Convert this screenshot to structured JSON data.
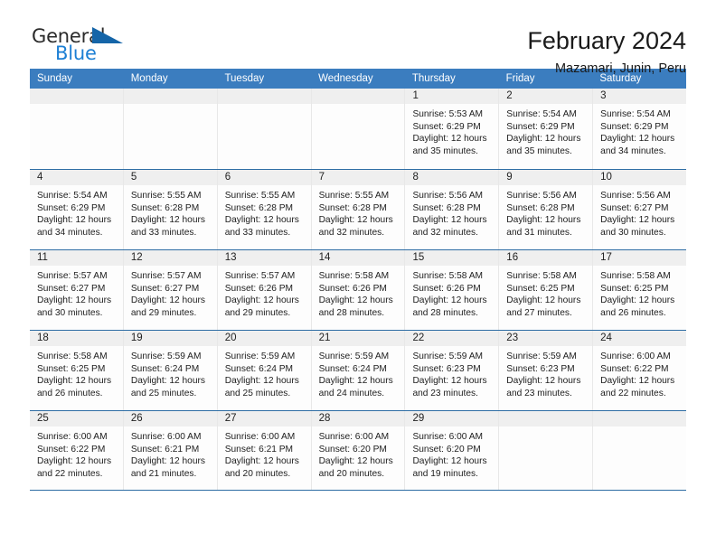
{
  "brand": {
    "word_one": "General",
    "word_two": "Blue",
    "triangle_icon": "triangle-icon",
    "accent_color": "#1c7fd4",
    "triangle_color": "#1565a8"
  },
  "header": {
    "title": "February 2024",
    "subtitle": "Mazamari, Junin, Peru"
  },
  "calendar": {
    "header_bg": "#3b7dbf",
    "row_rule_color": "#2e6da4",
    "daynum_bg": "#efefef",
    "day_names": [
      "Sunday",
      "Monday",
      "Tuesday",
      "Wednesday",
      "Thursday",
      "Friday",
      "Saturday"
    ],
    "weeks": [
      [
        {
          "day": "",
          "lines": []
        },
        {
          "day": "",
          "lines": []
        },
        {
          "day": "",
          "lines": []
        },
        {
          "day": "",
          "lines": []
        },
        {
          "day": "1",
          "lines": [
            "Sunrise: 5:53 AM",
            "Sunset: 6:29 PM",
            "Daylight: 12 hours",
            "and 35 minutes."
          ]
        },
        {
          "day": "2",
          "lines": [
            "Sunrise: 5:54 AM",
            "Sunset: 6:29 PM",
            "Daylight: 12 hours",
            "and 35 minutes."
          ]
        },
        {
          "day": "3",
          "lines": [
            "Sunrise: 5:54 AM",
            "Sunset: 6:29 PM",
            "Daylight: 12 hours",
            "and 34 minutes."
          ]
        }
      ],
      [
        {
          "day": "4",
          "lines": [
            "Sunrise: 5:54 AM",
            "Sunset: 6:29 PM",
            "Daylight: 12 hours",
            "and 34 minutes."
          ]
        },
        {
          "day": "5",
          "lines": [
            "Sunrise: 5:55 AM",
            "Sunset: 6:28 PM",
            "Daylight: 12 hours",
            "and 33 minutes."
          ]
        },
        {
          "day": "6",
          "lines": [
            "Sunrise: 5:55 AM",
            "Sunset: 6:28 PM",
            "Daylight: 12 hours",
            "and 33 minutes."
          ]
        },
        {
          "day": "7",
          "lines": [
            "Sunrise: 5:55 AM",
            "Sunset: 6:28 PM",
            "Daylight: 12 hours",
            "and 32 minutes."
          ]
        },
        {
          "day": "8",
          "lines": [
            "Sunrise: 5:56 AM",
            "Sunset: 6:28 PM",
            "Daylight: 12 hours",
            "and 32 minutes."
          ]
        },
        {
          "day": "9",
          "lines": [
            "Sunrise: 5:56 AM",
            "Sunset: 6:28 PM",
            "Daylight: 12 hours",
            "and 31 minutes."
          ]
        },
        {
          "day": "10",
          "lines": [
            "Sunrise: 5:56 AM",
            "Sunset: 6:27 PM",
            "Daylight: 12 hours",
            "and 30 minutes."
          ]
        }
      ],
      [
        {
          "day": "11",
          "lines": [
            "Sunrise: 5:57 AM",
            "Sunset: 6:27 PM",
            "Daylight: 12 hours",
            "and 30 minutes."
          ]
        },
        {
          "day": "12",
          "lines": [
            "Sunrise: 5:57 AM",
            "Sunset: 6:27 PM",
            "Daylight: 12 hours",
            "and 29 minutes."
          ]
        },
        {
          "day": "13",
          "lines": [
            "Sunrise: 5:57 AM",
            "Sunset: 6:26 PM",
            "Daylight: 12 hours",
            "and 29 minutes."
          ]
        },
        {
          "day": "14",
          "lines": [
            "Sunrise: 5:58 AM",
            "Sunset: 6:26 PM",
            "Daylight: 12 hours",
            "and 28 minutes."
          ]
        },
        {
          "day": "15",
          "lines": [
            "Sunrise: 5:58 AM",
            "Sunset: 6:26 PM",
            "Daylight: 12 hours",
            "and 28 minutes."
          ]
        },
        {
          "day": "16",
          "lines": [
            "Sunrise: 5:58 AM",
            "Sunset: 6:25 PM",
            "Daylight: 12 hours",
            "and 27 minutes."
          ]
        },
        {
          "day": "17",
          "lines": [
            "Sunrise: 5:58 AM",
            "Sunset: 6:25 PM",
            "Daylight: 12 hours",
            "and 26 minutes."
          ]
        }
      ],
      [
        {
          "day": "18",
          "lines": [
            "Sunrise: 5:58 AM",
            "Sunset: 6:25 PM",
            "Daylight: 12 hours",
            "and 26 minutes."
          ]
        },
        {
          "day": "19",
          "lines": [
            "Sunrise: 5:59 AM",
            "Sunset: 6:24 PM",
            "Daylight: 12 hours",
            "and 25 minutes."
          ]
        },
        {
          "day": "20",
          "lines": [
            "Sunrise: 5:59 AM",
            "Sunset: 6:24 PM",
            "Daylight: 12 hours",
            "and 25 minutes."
          ]
        },
        {
          "day": "21",
          "lines": [
            "Sunrise: 5:59 AM",
            "Sunset: 6:24 PM",
            "Daylight: 12 hours",
            "and 24 minutes."
          ]
        },
        {
          "day": "22",
          "lines": [
            "Sunrise: 5:59 AM",
            "Sunset: 6:23 PM",
            "Daylight: 12 hours",
            "and 23 minutes."
          ]
        },
        {
          "day": "23",
          "lines": [
            "Sunrise: 5:59 AM",
            "Sunset: 6:23 PM",
            "Daylight: 12 hours",
            "and 23 minutes."
          ]
        },
        {
          "day": "24",
          "lines": [
            "Sunrise: 6:00 AM",
            "Sunset: 6:22 PM",
            "Daylight: 12 hours",
            "and 22 minutes."
          ]
        }
      ],
      [
        {
          "day": "25",
          "lines": [
            "Sunrise: 6:00 AM",
            "Sunset: 6:22 PM",
            "Daylight: 12 hours",
            "and 22 minutes."
          ]
        },
        {
          "day": "26",
          "lines": [
            "Sunrise: 6:00 AM",
            "Sunset: 6:21 PM",
            "Daylight: 12 hours",
            "and 21 minutes."
          ]
        },
        {
          "day": "27",
          "lines": [
            "Sunrise: 6:00 AM",
            "Sunset: 6:21 PM",
            "Daylight: 12 hours",
            "and 20 minutes."
          ]
        },
        {
          "day": "28",
          "lines": [
            "Sunrise: 6:00 AM",
            "Sunset: 6:20 PM",
            "Daylight: 12 hours",
            "and 20 minutes."
          ]
        },
        {
          "day": "29",
          "lines": [
            "Sunrise: 6:00 AM",
            "Sunset: 6:20 PM",
            "Daylight: 12 hours",
            "and 19 minutes."
          ]
        },
        {
          "day": "",
          "lines": []
        },
        {
          "day": "",
          "lines": []
        }
      ]
    ]
  }
}
